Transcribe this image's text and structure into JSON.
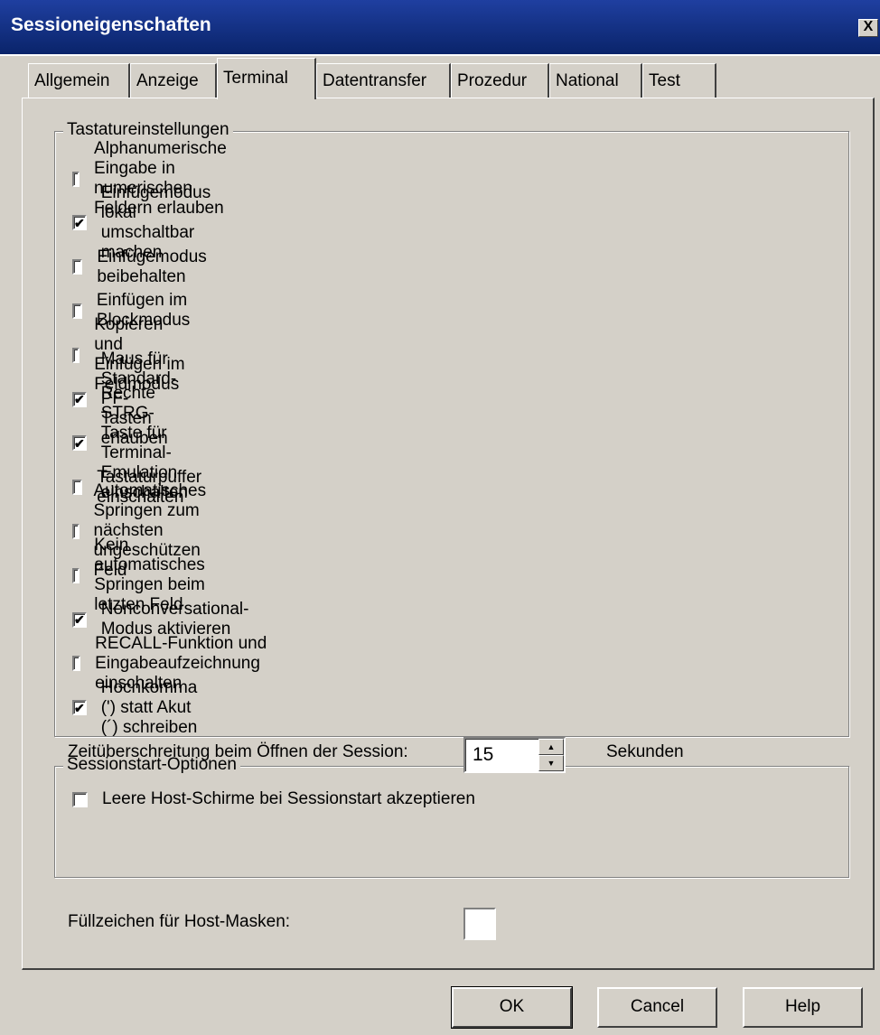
{
  "window": {
    "title": "Sessioneigenschaften",
    "close_label": "X"
  },
  "tabs": [
    {
      "label": "Allgemein",
      "active": false
    },
    {
      "label": "Anzeige",
      "active": false
    },
    {
      "label": "Terminal",
      "active": true
    },
    {
      "label": "Datentransfer",
      "active": false
    },
    {
      "label": "Prozedur",
      "active": false
    },
    {
      "label": "National",
      "active": false
    },
    {
      "label": "Test",
      "active": false
    }
  ],
  "keyboard_group": {
    "title": "Tastatureinstellungen",
    "options": [
      {
        "label": "Alphanumerische Eingabe in numerischen Feldern erlauben",
        "checked": false
      },
      {
        "label": "Einfügemodus lokal umschaltbar machen",
        "checked": true
      },
      {
        "label": "Einfügemodus beibehalten",
        "checked": false
      },
      {
        "label": "Einfügen im Blockmodus",
        "checked": false
      },
      {
        "label": "Kopieren und Einfügen im Feldmodus",
        "checked": false
      },
      {
        "label": "Maus für Standard-PF-Tasten erlauben",
        "checked": true
      },
      {
        "label": "Rechte STRG-Taste für Terminal-Emulation einschalten",
        "checked": true
      },
      {
        "label": "Tastaturpuffer einschalten",
        "checked": false
      },
      {
        "label": "Automatisches Springen zum nächsten ungeschützen Feld",
        "checked": false
      },
      {
        "label": "Kein automatisches Springen beim letzten Feld",
        "checked": false
      },
      {
        "label": "Nonconversational-Modus aktivieren",
        "checked": true
      },
      {
        "label": "RECALL-Funktion und Eingabeaufzeichnung einschalten",
        "checked": false
      },
      {
        "label": "Hochkomma (') statt Akut (´) schreiben",
        "checked": true
      }
    ]
  },
  "session_group": {
    "title": "Sessionstart-Optionen",
    "accept_empty": {
      "label": "Leere Host-Schirme bei Sessionstart akzeptieren",
      "checked": false
    },
    "timeout_label": "Zeitüberschreitung beim Öffnen der Session:",
    "timeout_value": "15",
    "timeout_unit": "Sekunden"
  },
  "fill_char": {
    "label": "Füllzeichen für Host-Masken:",
    "value": ""
  },
  "buttons": {
    "ok": "OK",
    "cancel": "Cancel",
    "help": "Help"
  }
}
